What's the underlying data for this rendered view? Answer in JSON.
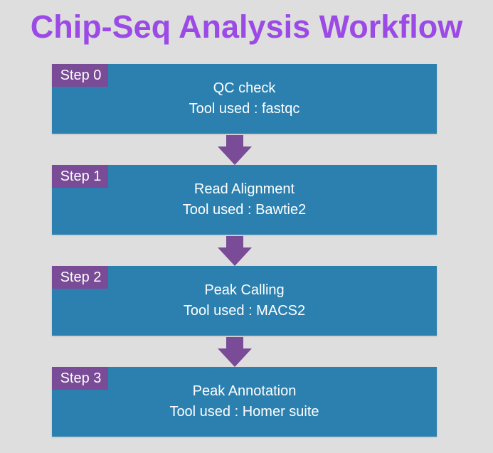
{
  "title": "Chip-Seq Analysis Workflow",
  "colors": {
    "title": "#9b4ae6",
    "box": "#2b80b0",
    "tag": "#7a4b97",
    "arrow": "#7a4b97",
    "background": "#dedede"
  },
  "steps": [
    {
      "tag": "Step 0",
      "name": "QC check",
      "tool": "Tool used : fastqc"
    },
    {
      "tag": "Step 1",
      "name": "Read Alignment",
      "tool": "Tool used : Bawtie2"
    },
    {
      "tag": "Step 2",
      "name": "Peak Calling",
      "tool": "Tool used : MACS2"
    },
    {
      "tag": "Step 3",
      "name": "Peak Annotation",
      "tool": "Tool used : Homer suite"
    }
  ]
}
